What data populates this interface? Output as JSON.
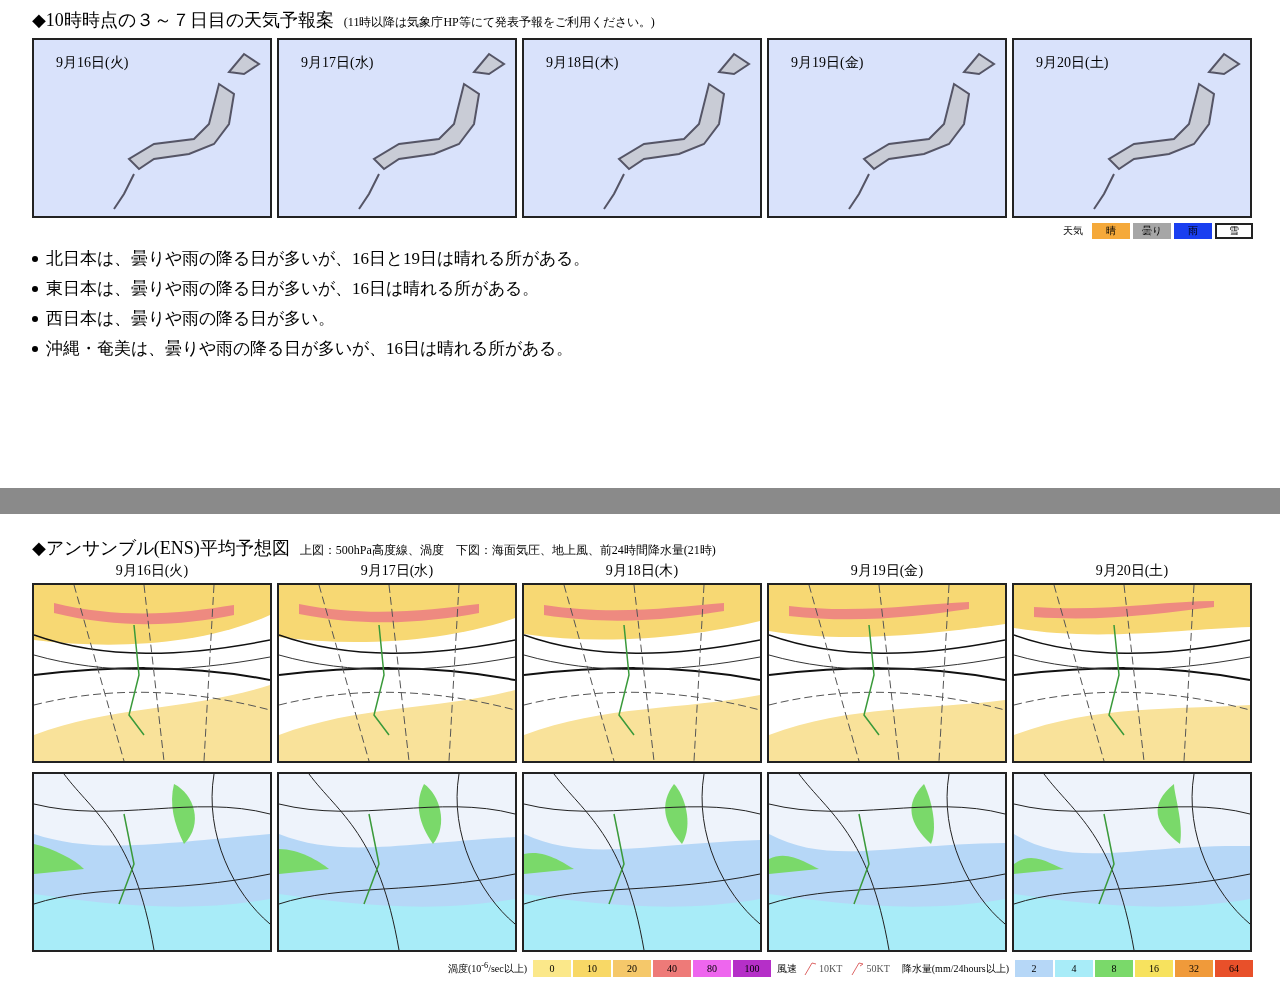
{
  "forecast": {
    "title": "◆10時時点の３～７日目の天気予報案",
    "note": "(11時以降は気象庁HP等にて発表予報をご利用ください。)",
    "maps": [
      {
        "date": "9月16日(火)"
      },
      {
        "date": "9月17日(水)"
      },
      {
        "date": "9月18日(木)"
      },
      {
        "date": "9月19日(金)"
      },
      {
        "date": "9月20日(土)"
      }
    ],
    "legend": {
      "label": "天気",
      "items": [
        {
          "label": "晴",
          "color": "#f5a93a"
        },
        {
          "label": "曇り",
          "color": "#a6a6a6"
        },
        {
          "label": "雨",
          "color": "#1a3ff0"
        },
        {
          "label": "雪",
          "color": "#ffffff"
        }
      ]
    },
    "bullets": [
      "北日本は、曇りや雨の降る日が多いが、16日と19日は晴れる所がある。",
      "東日本は、曇りや雨の降る日が多いが、16日は晴れる所がある。",
      "西日本は、曇りや雨の降る日が多い。",
      "沖縄・奄美は、曇りや雨の降る日が多いが、16日は晴れる所がある。"
    ]
  },
  "ensemble": {
    "title": "◆アンサンブル(ENS)平均予想図",
    "subtitle": "上図：500hPa高度線、渦度　下図：海面気圧、地上風、前24時間降水量(21時)",
    "days": [
      {
        "date": "9月16日(火)"
      },
      {
        "date": "9月17日(水)"
      },
      {
        "date": "9月18日(木)"
      },
      {
        "date": "9月19日(金)"
      },
      {
        "date": "9月20日(土)"
      }
    ],
    "legend": {
      "vorticity_label": "渦度(10$^{-6}$/sec以上)",
      "vorticity": [
        {
          "label": "0",
          "color": "#fbe88a"
        },
        {
          "label": "10",
          "color": "#f8d866"
        },
        {
          "label": "20",
          "color": "#f5c86a"
        },
        {
          "label": "40",
          "color": "#ee7a78"
        },
        {
          "label": "80",
          "color": "#ee66ee"
        },
        {
          "label": "100",
          "color": "#b52fc8"
        }
      ],
      "wind_label": "風速",
      "wind": [
        {
          "label": "10KT"
        },
        {
          "label": "50KT"
        }
      ],
      "precip_label": "降水量(mm/24hours以上)",
      "precip": [
        {
          "label": "2",
          "color": "#b6d7f7"
        },
        {
          "label": "4",
          "color": "#a8ecf8"
        },
        {
          "label": "8",
          "color": "#7ad96a"
        },
        {
          "label": "16",
          "color": "#f7e25e"
        },
        {
          "label": "32",
          "color": "#f09a3a"
        },
        {
          "label": "64",
          "color": "#e8502a"
        }
      ]
    }
  }
}
